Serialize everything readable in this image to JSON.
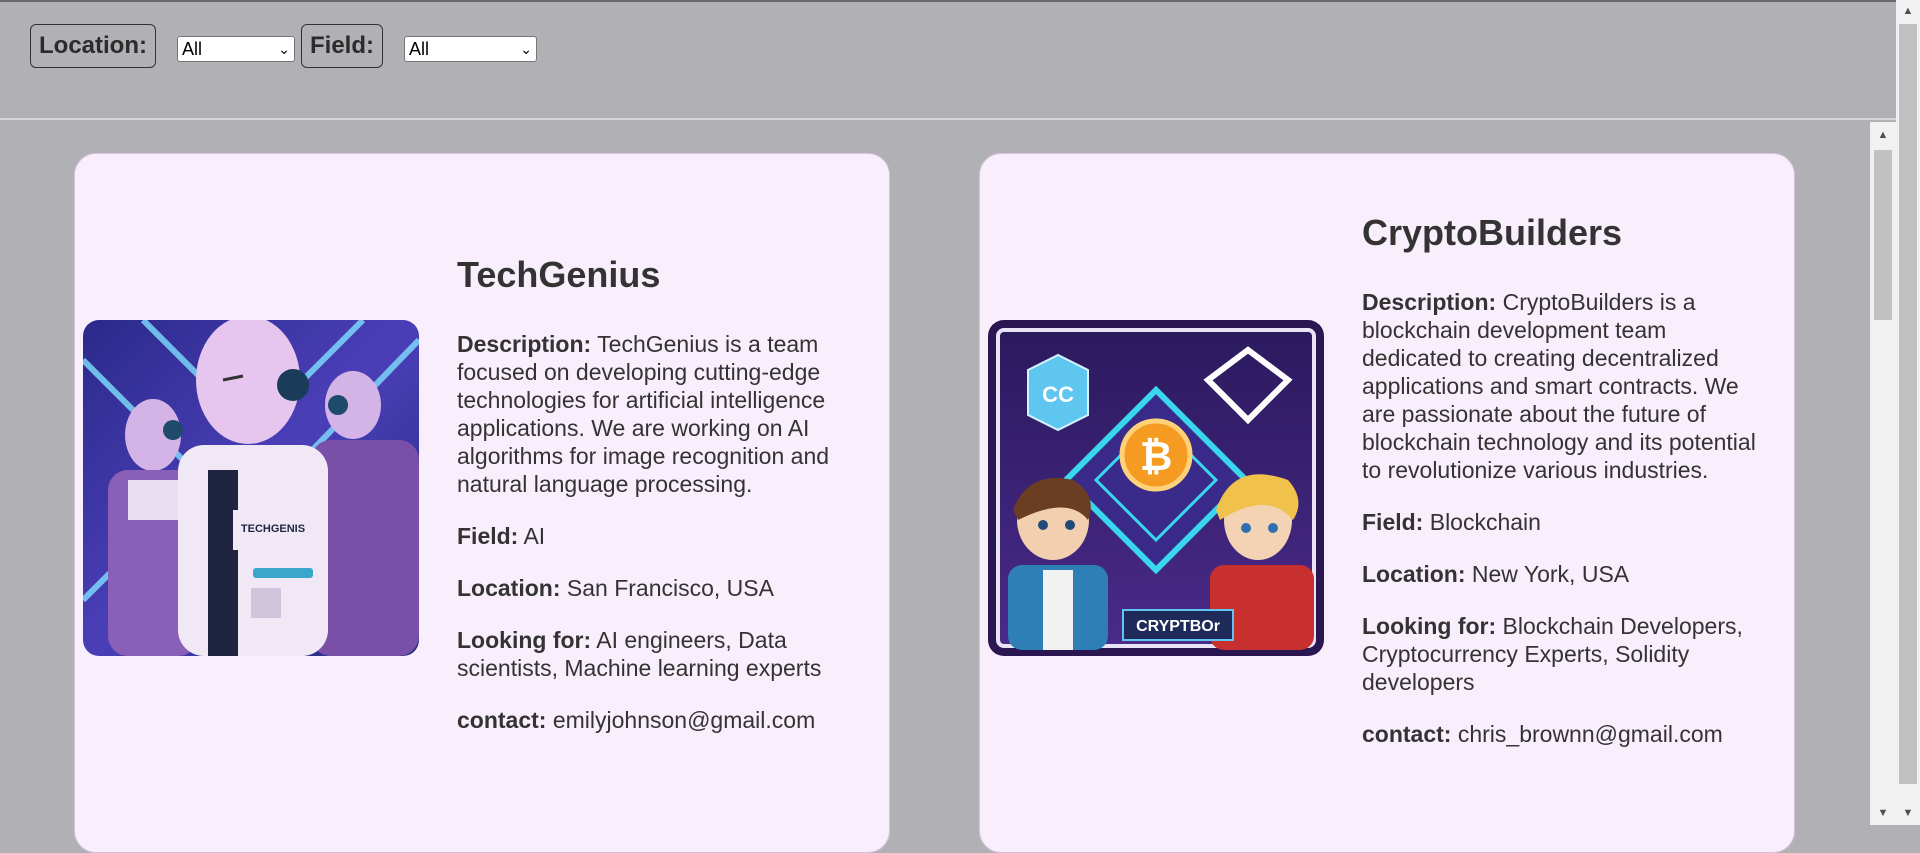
{
  "filters": {
    "location_label": "Location:",
    "location_value": "All",
    "field_label": "Field:",
    "field_value": "All"
  },
  "labels": {
    "description": "Description:",
    "field": "Field:",
    "location": "Location:",
    "looking_for": "Looking for:",
    "contact": "contact:"
  },
  "cards": [
    {
      "title": "TechGenius",
      "description": "TechGenius is a team focused on developing cutting-edge technologies for artificial intelligence applications. We are working on AI algorithms for image recognition and natural language processing.",
      "field": "AI",
      "location": "San Francisco, USA",
      "looking_for": "AI engineers, Data scientists, Machine learning experts",
      "contact": "emilyjohnson@gmail.com",
      "image_text": "TECHGENIS",
      "image_icon": "robot-team-illustration"
    },
    {
      "title": "CryptoBuilders",
      "description": "CryptoBuilders is a blockchain development team dedicated to creating decentralized applications and smart contracts. We are passionate about the future of blockchain technology and its potential to revolutionize various industries.",
      "field": "Blockchain",
      "location": "New York, USA",
      "looking_for": "Blockchain Developers, Cryptocurrency Experts, Solidity developers",
      "contact": "chris_brownn@gmail.com",
      "image_text": "CRYPTBOr",
      "image_logo": "CC",
      "image_coin": "₿",
      "image_icon": "crypto-team-illustration"
    }
  ],
  "colors": {
    "page_bg": "#b1b0b5",
    "card_bg": "#f9eefb",
    "text": "#333333"
  }
}
